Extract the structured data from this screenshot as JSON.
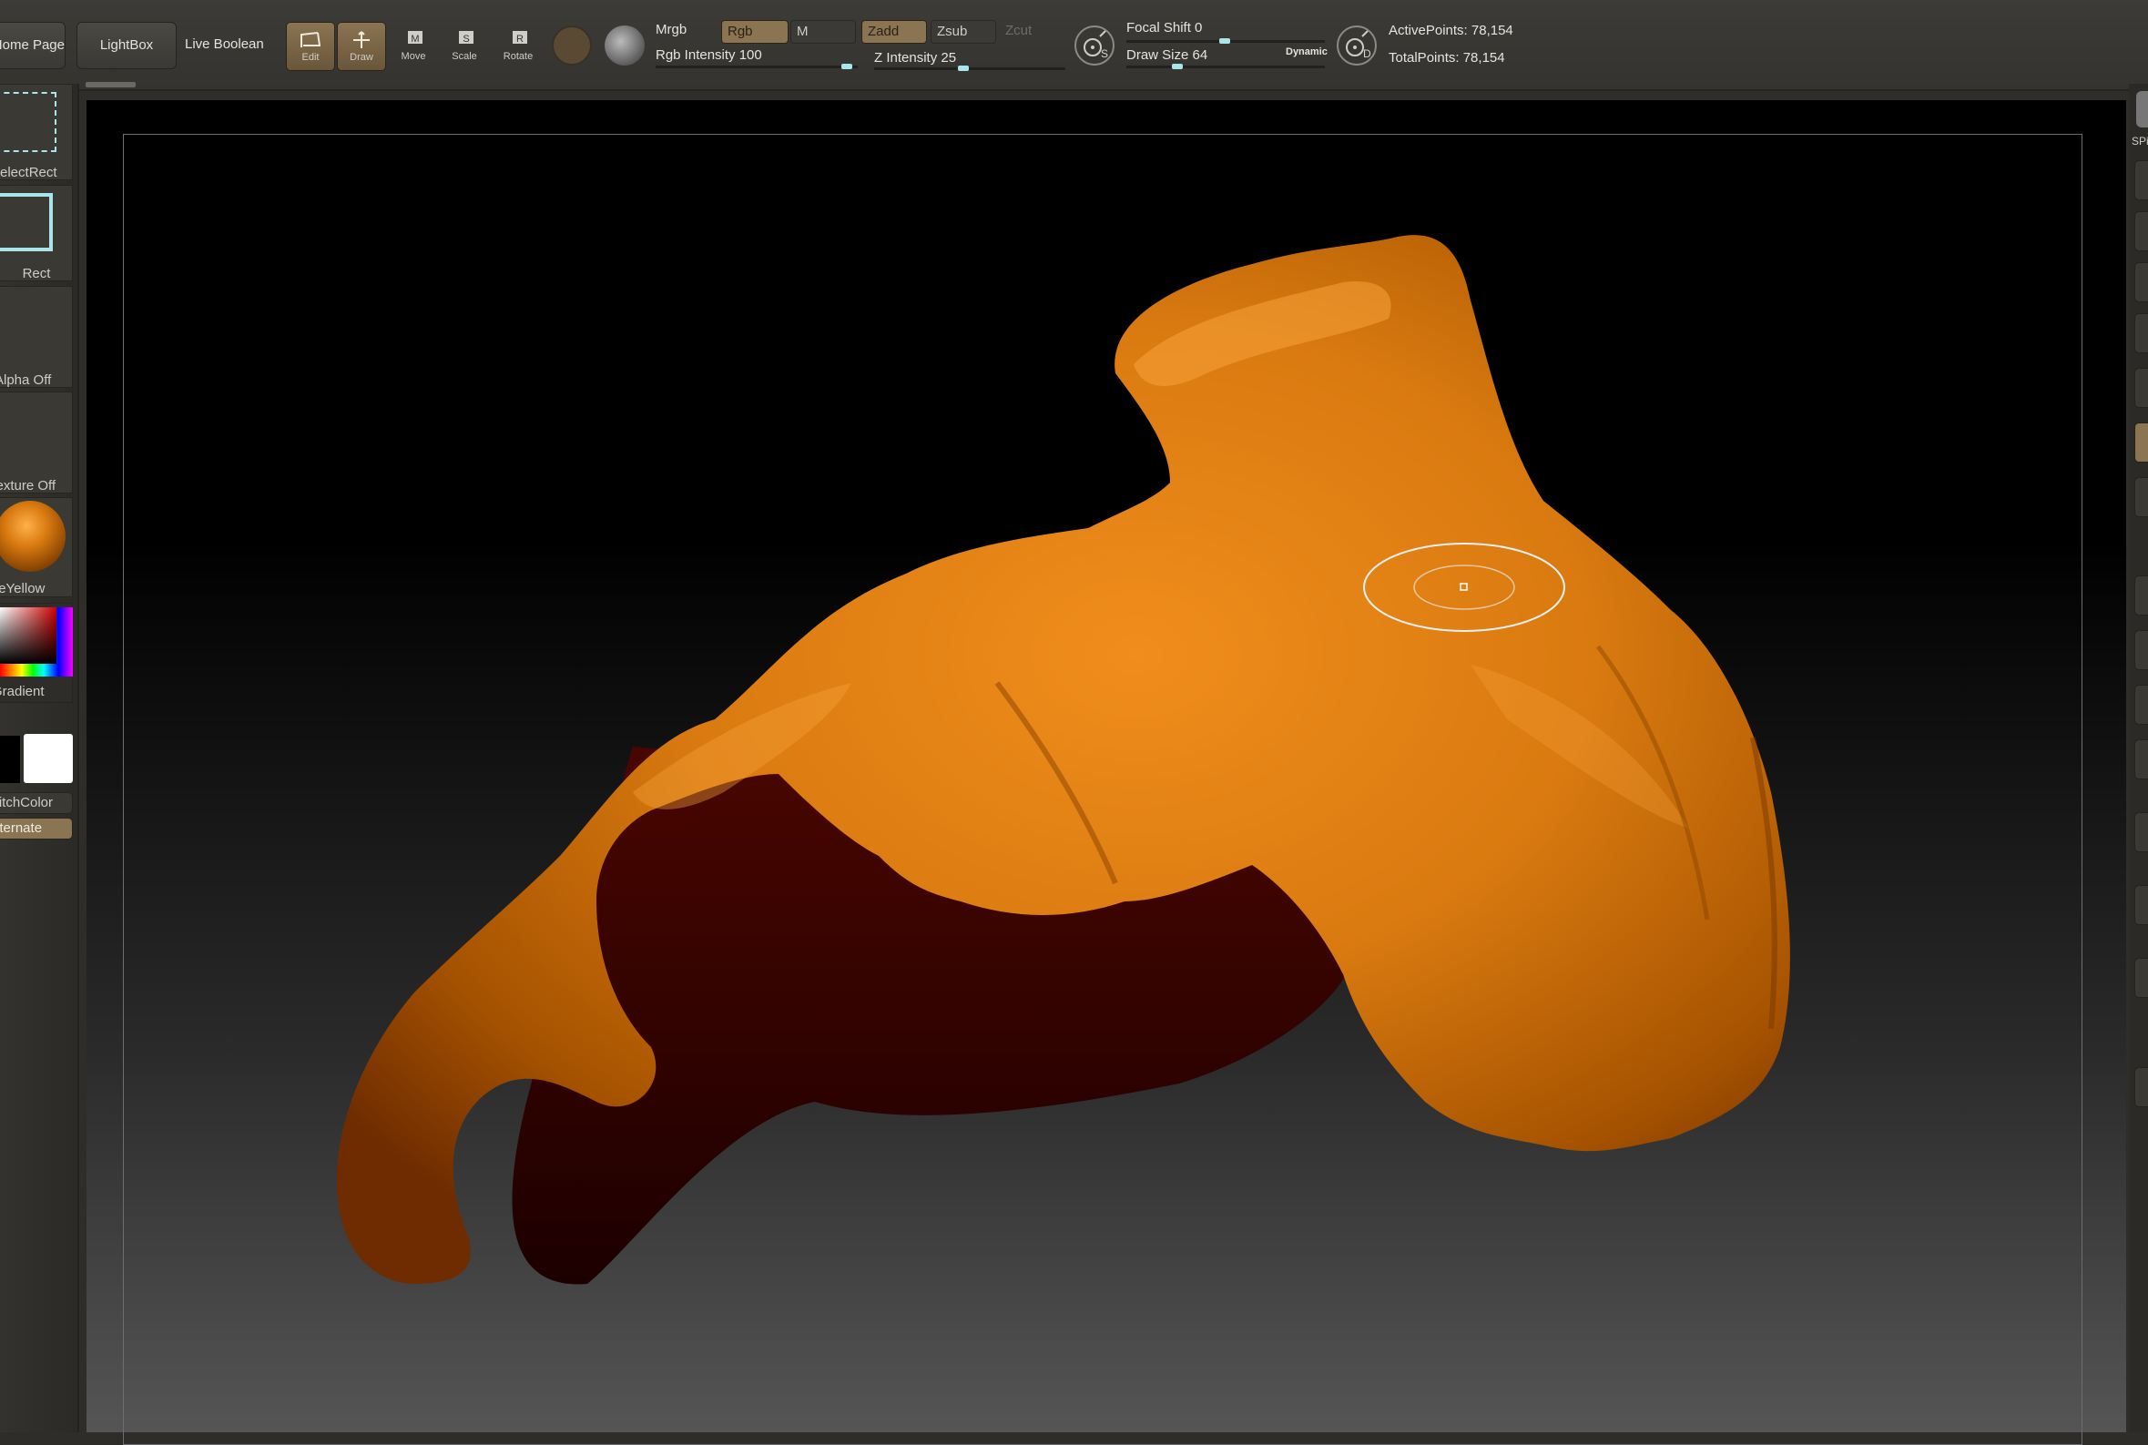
{
  "toolbar": {
    "home_page": "Home Page",
    "lightbox": "LightBox",
    "live_boolean": "Live Boolean",
    "tools": {
      "edit": "Edit",
      "draw": "Draw",
      "move": "Move",
      "scale": "Scale",
      "rotate": "Rotate"
    },
    "modes": {
      "mrgb": "Mrgb",
      "rgb": "Rgb",
      "m": "M",
      "zadd": "Zadd",
      "zsub": "Zsub",
      "zcut": "Zcut"
    },
    "rgb_intensity_label": "Rgb Intensity",
    "rgb_intensity_value": "100",
    "z_intensity_label": "Z Intensity",
    "z_intensity_value": "25",
    "focal_shift_label": "Focal Shift",
    "focal_shift_value": "0",
    "draw_size_label": "Draw Size",
    "draw_size_value": "64",
    "dynamic": "Dynamic",
    "active_points_label": "ActivePoints:",
    "active_points_value": "78,154",
    "total_points_label": "TotalPoints:",
    "total_points_value": "78,154",
    "size_icon_s": "S",
    "size_icon_d": "D"
  },
  "shelf": {
    "select_rect": "SelectRect",
    "rect": "Rect",
    "alpha_off": "Alpha Off",
    "texture_off": "Texture Off",
    "material": "SkinShadeYellow",
    "gradient": "Gradient",
    "switch_color": "SwitchColor",
    "alternate": "Alternate"
  },
  "right_shelf": {
    "spix_label": "SPix"
  },
  "colors": {
    "model": "#d97a10",
    "model_shadow": "#2a0000",
    "ui_accent": "#8a7452",
    "slider_knob": "#a9e5ea"
  },
  "icons": [
    "edit-icon",
    "draw-icon",
    "move-icon",
    "scale-icon",
    "rotate-icon",
    "brush-cursor-icon"
  ]
}
